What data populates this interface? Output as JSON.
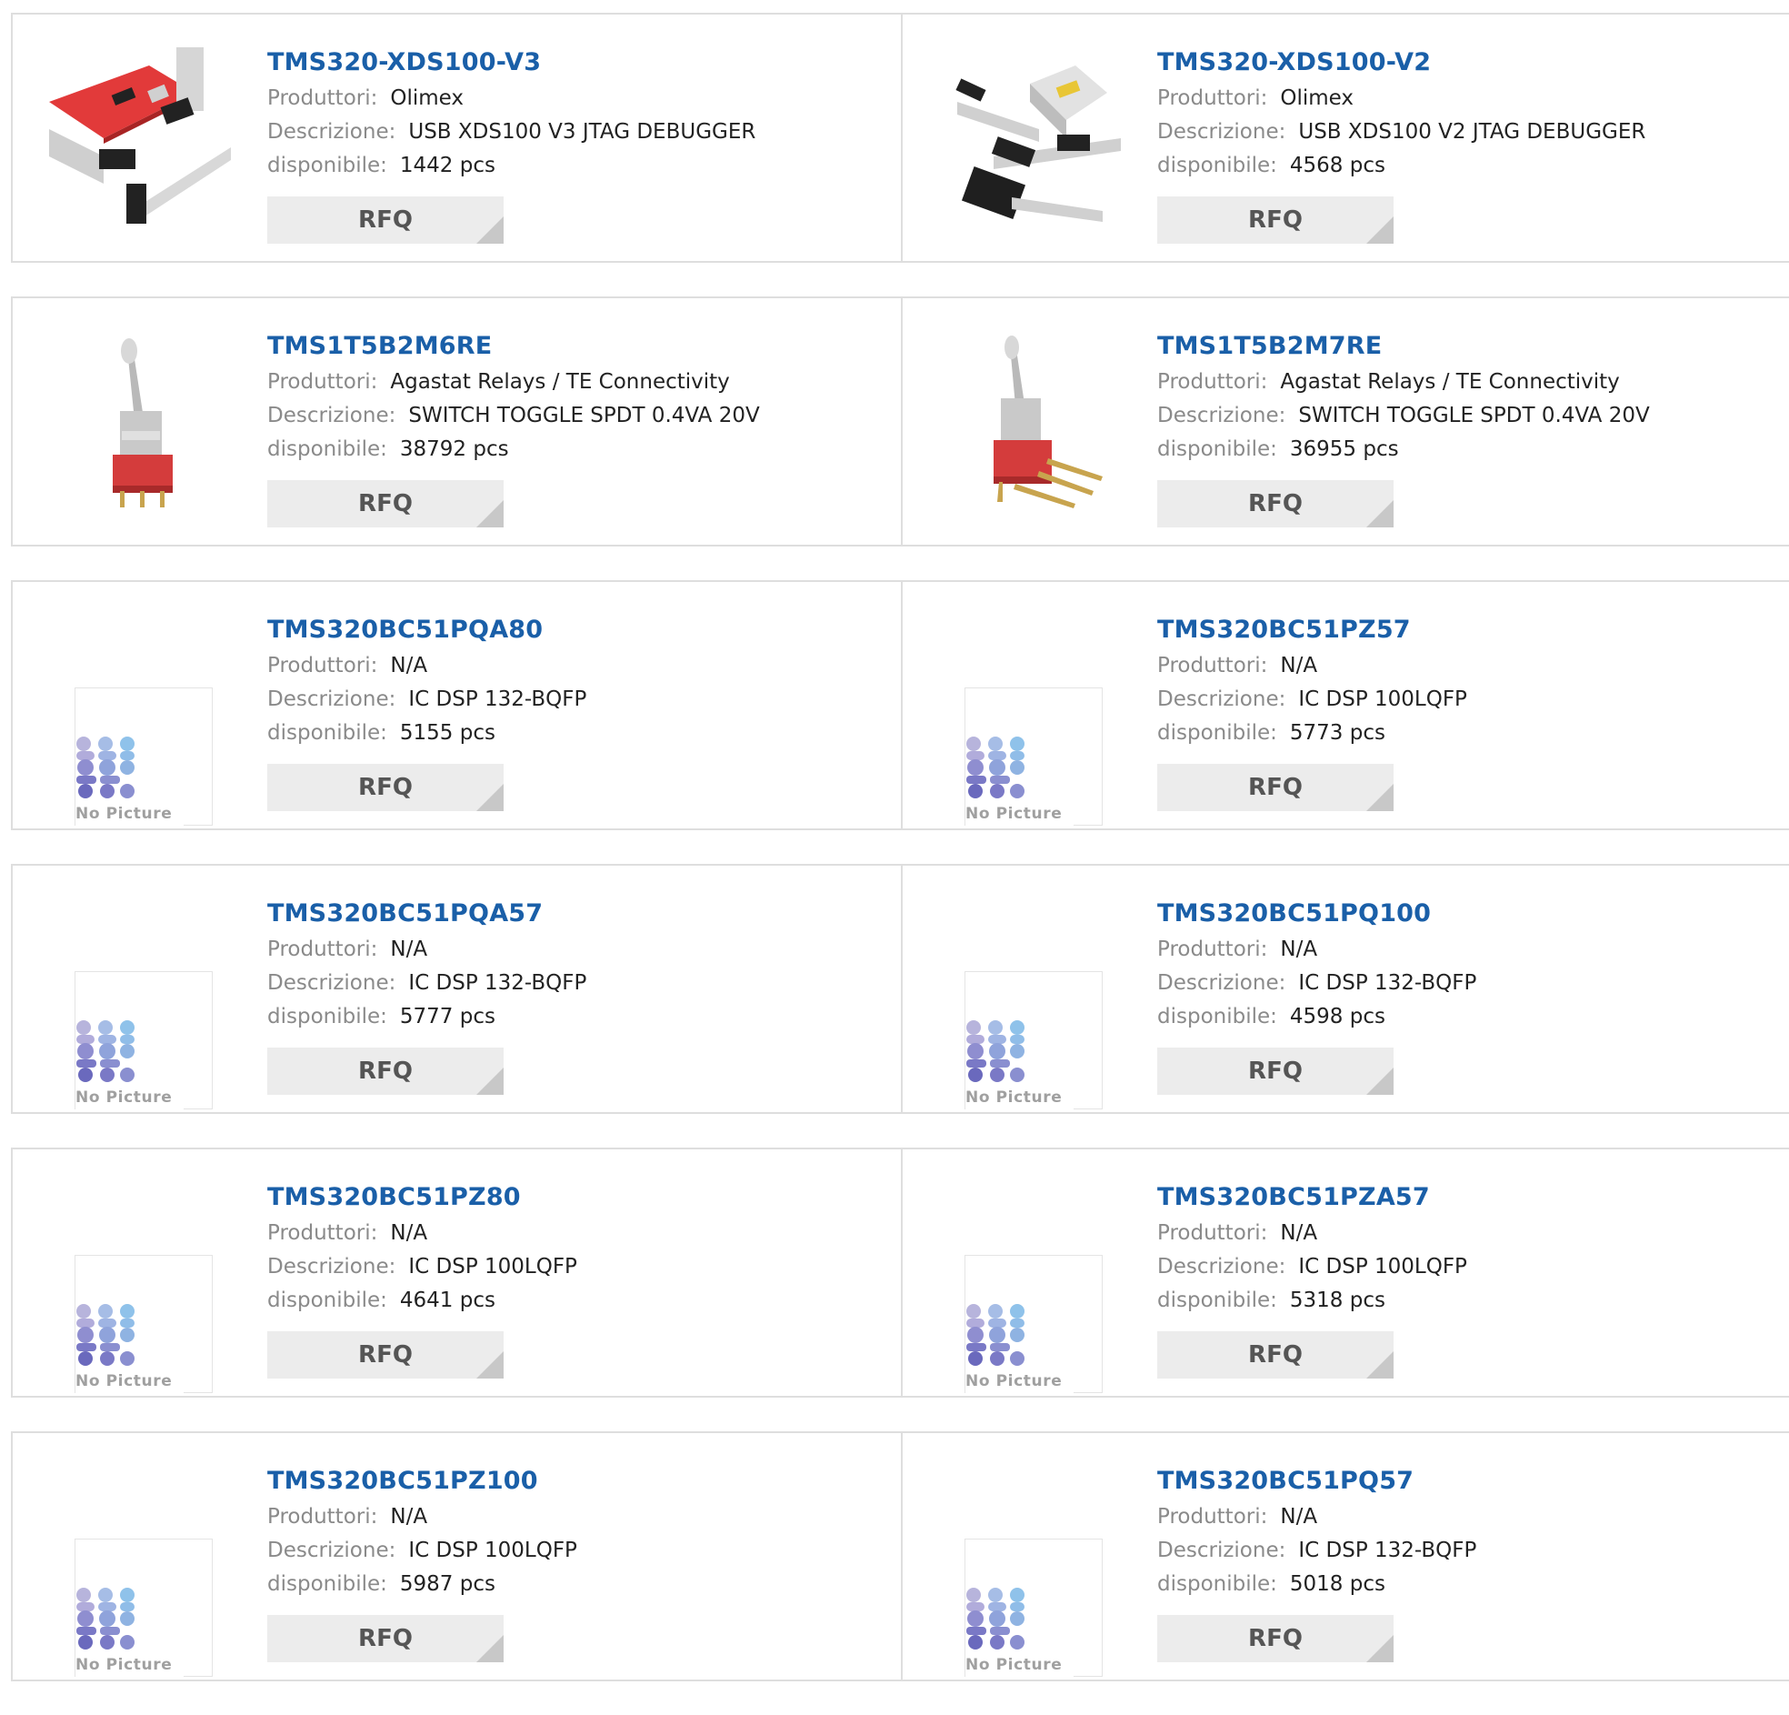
{
  "labels": {
    "manufacturer": "Produttori:",
    "description": "Descrizione:",
    "stock": "disponibile:",
    "rfq": "RFQ",
    "no_picture": "No Picture"
  },
  "products": [
    {
      "part": "TMS320-XDS100-V3",
      "manufacturer": "Olimex",
      "description": "USB XDS100 V3 JTAG DEBUGGER",
      "stock": "1442 pcs",
      "image": "jtag-debugger-v3-photo"
    },
    {
      "part": "TMS320-XDS100-V2",
      "manufacturer": "Olimex",
      "description": "USB XDS100 V2 JTAG DEBUGGER",
      "stock": "4568 pcs",
      "image": "jtag-debugger-v2-photo"
    },
    {
      "part": "TMS1T5B2M6RE",
      "manufacturer": "Agastat Relays / TE Connectivity",
      "description": "SWITCH TOGGLE SPDT 0.4VA 20V",
      "stock": "38792 pcs",
      "image": "toggle-switch-photo"
    },
    {
      "part": "TMS1T5B2M7RE",
      "manufacturer": "Agastat Relays / TE Connectivity",
      "description": "SWITCH TOGGLE SPDT 0.4VA 20V",
      "stock": "36955 pcs",
      "image": "toggle-switch-right-angle-photo"
    },
    {
      "part": "TMS320BC51PQA80",
      "manufacturer": "N/A",
      "description": "IC DSP 132-BQFP",
      "stock": "5155 pcs",
      "image": "no-picture"
    },
    {
      "part": "TMS320BC51PZ57",
      "manufacturer": "N/A",
      "description": "IC DSP 100LQFP",
      "stock": "5773 pcs",
      "image": "no-picture"
    },
    {
      "part": "TMS320BC51PQA57",
      "manufacturer": "N/A",
      "description": "IC DSP 132-BQFP",
      "stock": "5777 pcs",
      "image": "no-picture"
    },
    {
      "part": "TMS320BC51PQ100",
      "manufacturer": "N/A",
      "description": "IC DSP 132-BQFP",
      "stock": "4598 pcs",
      "image": "no-picture"
    },
    {
      "part": "TMS320BC51PZ80",
      "manufacturer": "N/A",
      "description": "IC DSP 100LQFP",
      "stock": "4641 pcs",
      "image": "no-picture"
    },
    {
      "part": "TMS320BC51PZA57",
      "manufacturer": "N/A",
      "description": "IC DSP 100LQFP",
      "stock": "5318 pcs",
      "image": "no-picture"
    },
    {
      "part": "TMS320BC51PZ100",
      "manufacturer": "N/A",
      "description": "IC DSP 100LQFP",
      "stock": "5987 pcs",
      "image": "no-picture"
    },
    {
      "part": "TMS320BC51PQ57",
      "manufacturer": "N/A",
      "description": "IC DSP 132-BQFP",
      "stock": "5018 pcs",
      "image": "no-picture"
    }
  ],
  "colors": {
    "part_link": "#1a5fa8",
    "label_gray": "#8a8a8a",
    "border": "#dedede",
    "rfq_bg": "#ececec"
  }
}
